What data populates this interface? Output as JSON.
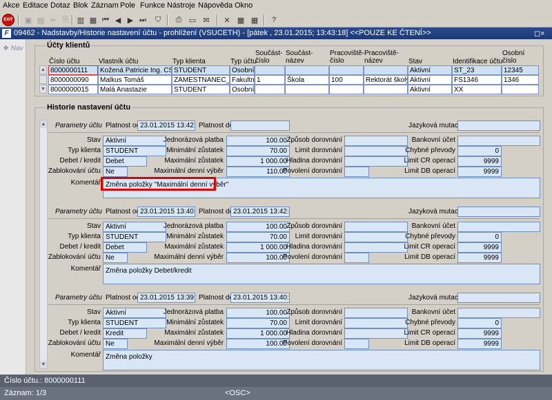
{
  "menu": [
    "Akce",
    "Editace",
    "Dotaz",
    "Blok",
    "Záznam",
    "Pole",
    "Funkce",
    "Nástroje",
    "Nápověda",
    "Okno"
  ],
  "toolbar": {
    "exit_label": "EXIT"
  },
  "window": {
    "title": "09462 - Nadstavby/Historie nastavení účtu - prohlížení (VSUCETH) - [pátek  , 23.01.2015; 13:43:18] <<POUZE KE ČTENÍ>>",
    "icon_letter": "F",
    "controls": "◻×"
  },
  "nav": {
    "label": "Nav"
  },
  "accounts": {
    "title": "Účty klientů",
    "headers": [
      "Číslo účtu",
      "Vlastník účtu",
      "Typ klienta",
      "Typ účtu",
      "Součást-\nčíslo",
      "Součást-\nnázev",
      "Pracoviště-\nčíslo",
      "Pracoviště-\nnázev",
      "Stav",
      "Identifikace účtu",
      "Osobní\nčíslo"
    ],
    "rows": [
      [
        "8000000111",
        "Kožená Patricie Ing. CSc.",
        "STUDENT",
        "Osobní",
        "",
        "",
        "",
        "",
        "Aktivní",
        "ST_23",
        "12345"
      ],
      [
        "8000000090",
        "Malkus Tomáš",
        "ZAMESTNANEC_SLU",
        "Fakultní",
        "1",
        "Škola",
        "100",
        "Rektorát školy",
        "Aktivní",
        "FS1346",
        "1346"
      ],
      [
        "8000000015",
        "Malá Anastazie",
        "STUDENT",
        "Osobní",
        "",
        "",
        "",
        "",
        "Aktivní",
        "XX",
        ""
      ]
    ]
  },
  "history": {
    "title": "Historie nastavení účtu",
    "labels": {
      "params": "Parametry účtu",
      "valid_from": "Platnost od",
      "valid_to": "Platnost do",
      "language": "Jazyková mutace",
      "state": "Stav",
      "client_type": "Typ klienta",
      "debit_credit": "Debet / kredit",
      "blocked": "Zablokování účtu",
      "one_time": "Jednorázová platba",
      "min_balance": "Minimální zůstatek",
      "max_balance": "Maximální zůstatek",
      "max_daily": "Maximální denní výběr",
      "topup_method": "Způsob dorovnání",
      "topup_limit": "Limit dorovnání",
      "topup_level": "Hladina dorovnání",
      "topup_allowed": "Povolení dorovnání",
      "bank_account": "Bankovní účet",
      "bad_transfers": "Chybné převody",
      "limit_cr": "Limit CR operací",
      "limit_db": "Limit DB operací",
      "comment": "Komentář"
    },
    "records": [
      {
        "valid_from": "23.01.2015 13:42:48",
        "valid_to": "",
        "language": "",
        "state": "Aktivní",
        "client_type": "STUDENT",
        "debit_credit": "Debet",
        "blocked": "Ne",
        "one_time": "100.00",
        "min_balance": "70.00",
        "max_balance": "1 000.00",
        "max_daily": "110.00",
        "topup_method": "",
        "topup_limit": "",
        "topup_level": "",
        "topup_allowed": "",
        "bank_account": "",
        "bad_transfers": "0",
        "limit_cr": "9999",
        "limit_db": "9999",
        "comment": "Změna položky \"Maximální denní výběr\""
      },
      {
        "valid_from": "23.01.2015 13:40:18",
        "valid_to": "23.01.2015 13:42:48",
        "language": "",
        "state": "Aktivní",
        "client_type": "STUDENT",
        "debit_credit": "Debet",
        "blocked": "Ne",
        "one_time": "100.00",
        "min_balance": "70.00",
        "max_balance": "1 000.00",
        "max_daily": "100.00",
        "topup_method": "",
        "topup_limit": "",
        "topup_level": "",
        "topup_allowed": "",
        "bank_account": "",
        "bad_transfers": "0",
        "limit_cr": "9999",
        "limit_db": "9999",
        "comment": "Změna položky Debet/kredit"
      },
      {
        "valid_from": "23.01.2015 13:39:48",
        "valid_to": "23.01.2015 13:40:18",
        "language": "",
        "state": "Aktivní",
        "client_type": "STUDENT",
        "debit_credit": "Kredit",
        "blocked": "Ne",
        "one_time": "100.00",
        "min_balance": "70.00",
        "max_balance": "1 000.00",
        "max_daily": "100.00",
        "topup_method": "",
        "topup_limit": "",
        "topup_level": "",
        "topup_allowed": "",
        "bank_account": "",
        "bad_transfers": "0",
        "limit_cr": "9999",
        "limit_db": "9999",
        "comment": "Změna položky"
      }
    ]
  },
  "status": {
    "line1": "Číslo účtu.: 8000000111",
    "record": "Záznam: 1/3",
    "mode": "<OSC>"
  }
}
